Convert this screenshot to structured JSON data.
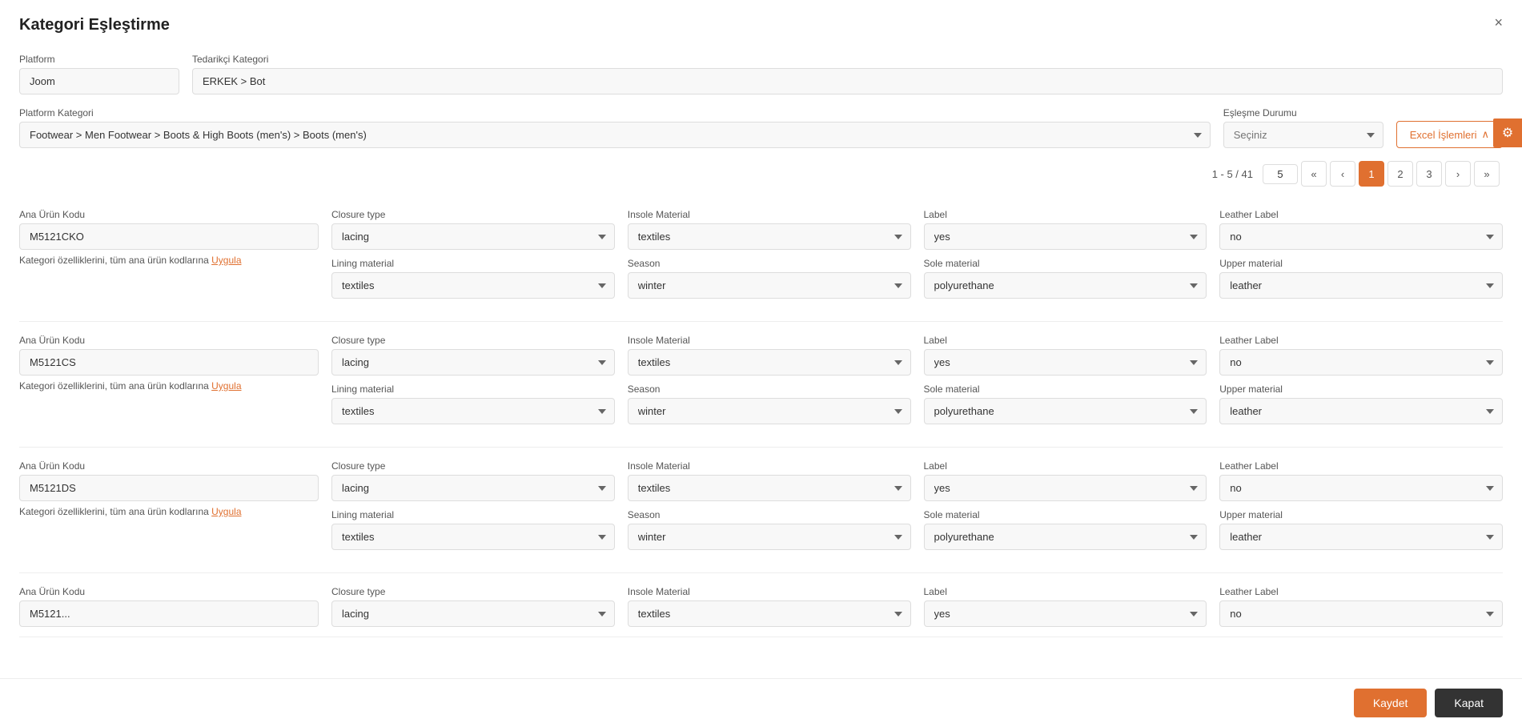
{
  "modal": {
    "title": "Kategori Eşleştirme",
    "close_label": "×"
  },
  "platform_field": {
    "label": "Platform",
    "value": "Joom"
  },
  "tedarikci_field": {
    "label": "Tedarikçi Kategori",
    "value": "ERKEK > Bot"
  },
  "platform_kategori": {
    "label": "Platform Kategori",
    "value": "Footwear > Men Footwear > Boots & High Boots (men's) > Boots (men's)"
  },
  "esleme_durumu": {
    "label": "Eşleşme Durumu",
    "placeholder": "Seçiniz"
  },
  "excel_btn": {
    "label": "Excel İşlemleri"
  },
  "pagination": {
    "info": "1 - 5 / 41",
    "page_size": "5",
    "pages": [
      "1",
      "2",
      "3"
    ],
    "current_page": "1",
    "first_label": "«",
    "prev_label": "‹",
    "next_label": "›",
    "last_label": "»"
  },
  "products": [
    {
      "code_label": "Ana Ürün Kodu",
      "code": "M5121CKO",
      "apply_text": "Kategori özelliklerini, tüm ana ürün kodlarına",
      "apply_link": "Uygula",
      "fields": {
        "row1": [
          {
            "label": "Closure type",
            "value": "lacing"
          },
          {
            "label": "Insole Material",
            "value": "textiles"
          },
          {
            "label": "Label",
            "value": "yes"
          },
          {
            "label": "Leather Label",
            "value": "no"
          }
        ],
        "row2": [
          {
            "label": "Lining material",
            "value": "textiles"
          },
          {
            "label": "Season",
            "value": "winter"
          },
          {
            "label": "Sole material",
            "value": "polyurethane"
          },
          {
            "label": "Upper material",
            "value": "leather"
          }
        ]
      }
    },
    {
      "code_label": "Ana Ürün Kodu",
      "code": "M5121CS",
      "apply_text": "Kategori özelliklerini, tüm ana ürün kodlarına",
      "apply_link": "Uygula",
      "fields": {
        "row1": [
          {
            "label": "Closure type",
            "value": "lacing"
          },
          {
            "label": "Insole Material",
            "value": "textiles"
          },
          {
            "label": "Label",
            "value": "yes"
          },
          {
            "label": "Leather Label",
            "value": "no"
          }
        ],
        "row2": [
          {
            "label": "Lining material",
            "value": "textiles"
          },
          {
            "label": "Season",
            "value": "winter"
          },
          {
            "label": "Sole material",
            "value": "polyurethane"
          },
          {
            "label": "Upper material",
            "value": "leather"
          }
        ]
      }
    },
    {
      "code_label": "Ana Ürün Kodu",
      "code": "M5121DS",
      "apply_text": "Kategori özelliklerini, tüm ana ürün kodlarına",
      "apply_link": "Uygula",
      "fields": {
        "row1": [
          {
            "label": "Closure type",
            "value": "lacing"
          },
          {
            "label": "Insole Material",
            "value": "textiles"
          },
          {
            "label": "Label",
            "value": "yes"
          },
          {
            "label": "Leather Label",
            "value": "no"
          }
        ],
        "row2": [
          {
            "label": "Lining material",
            "value": "textiles"
          },
          {
            "label": "Season",
            "value": "winter"
          },
          {
            "label": "Sole material",
            "value": "polyurethane"
          },
          {
            "label": "Upper material",
            "value": "leather"
          }
        ]
      }
    },
    {
      "code_label": "Ana Ürün Kodu",
      "code": "M5121...",
      "apply_text": "",
      "apply_link": "",
      "fields": {
        "row1": [
          {
            "label": "Closure type",
            "value": "lacing"
          },
          {
            "label": "Insole Material",
            "value": "textiles"
          },
          {
            "label": "Label",
            "value": "yes"
          },
          {
            "label": "Leather Label",
            "value": "no"
          }
        ],
        "row2": []
      }
    }
  ],
  "footer": {
    "save_label": "Kaydet",
    "close_label": "Kapat"
  },
  "settings_icon": "⚙"
}
